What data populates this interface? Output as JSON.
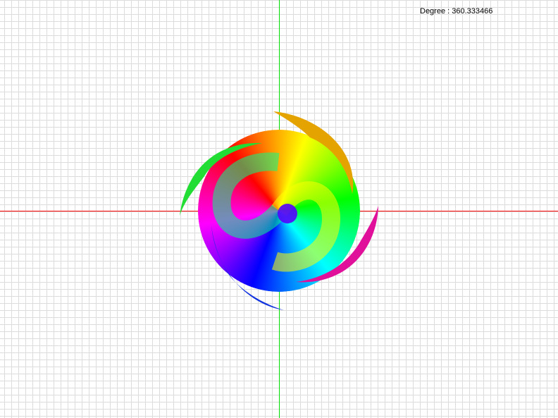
{
  "hud": {
    "degree_label": "Degree : 360.333466"
  },
  "colors": {
    "axis_x": "#ff0000",
    "axis_y": "#00dd00",
    "grid": "#dcdcdc"
  },
  "scene": {
    "object": "rainbow-swirl",
    "rotation_degrees": 360.333466
  }
}
